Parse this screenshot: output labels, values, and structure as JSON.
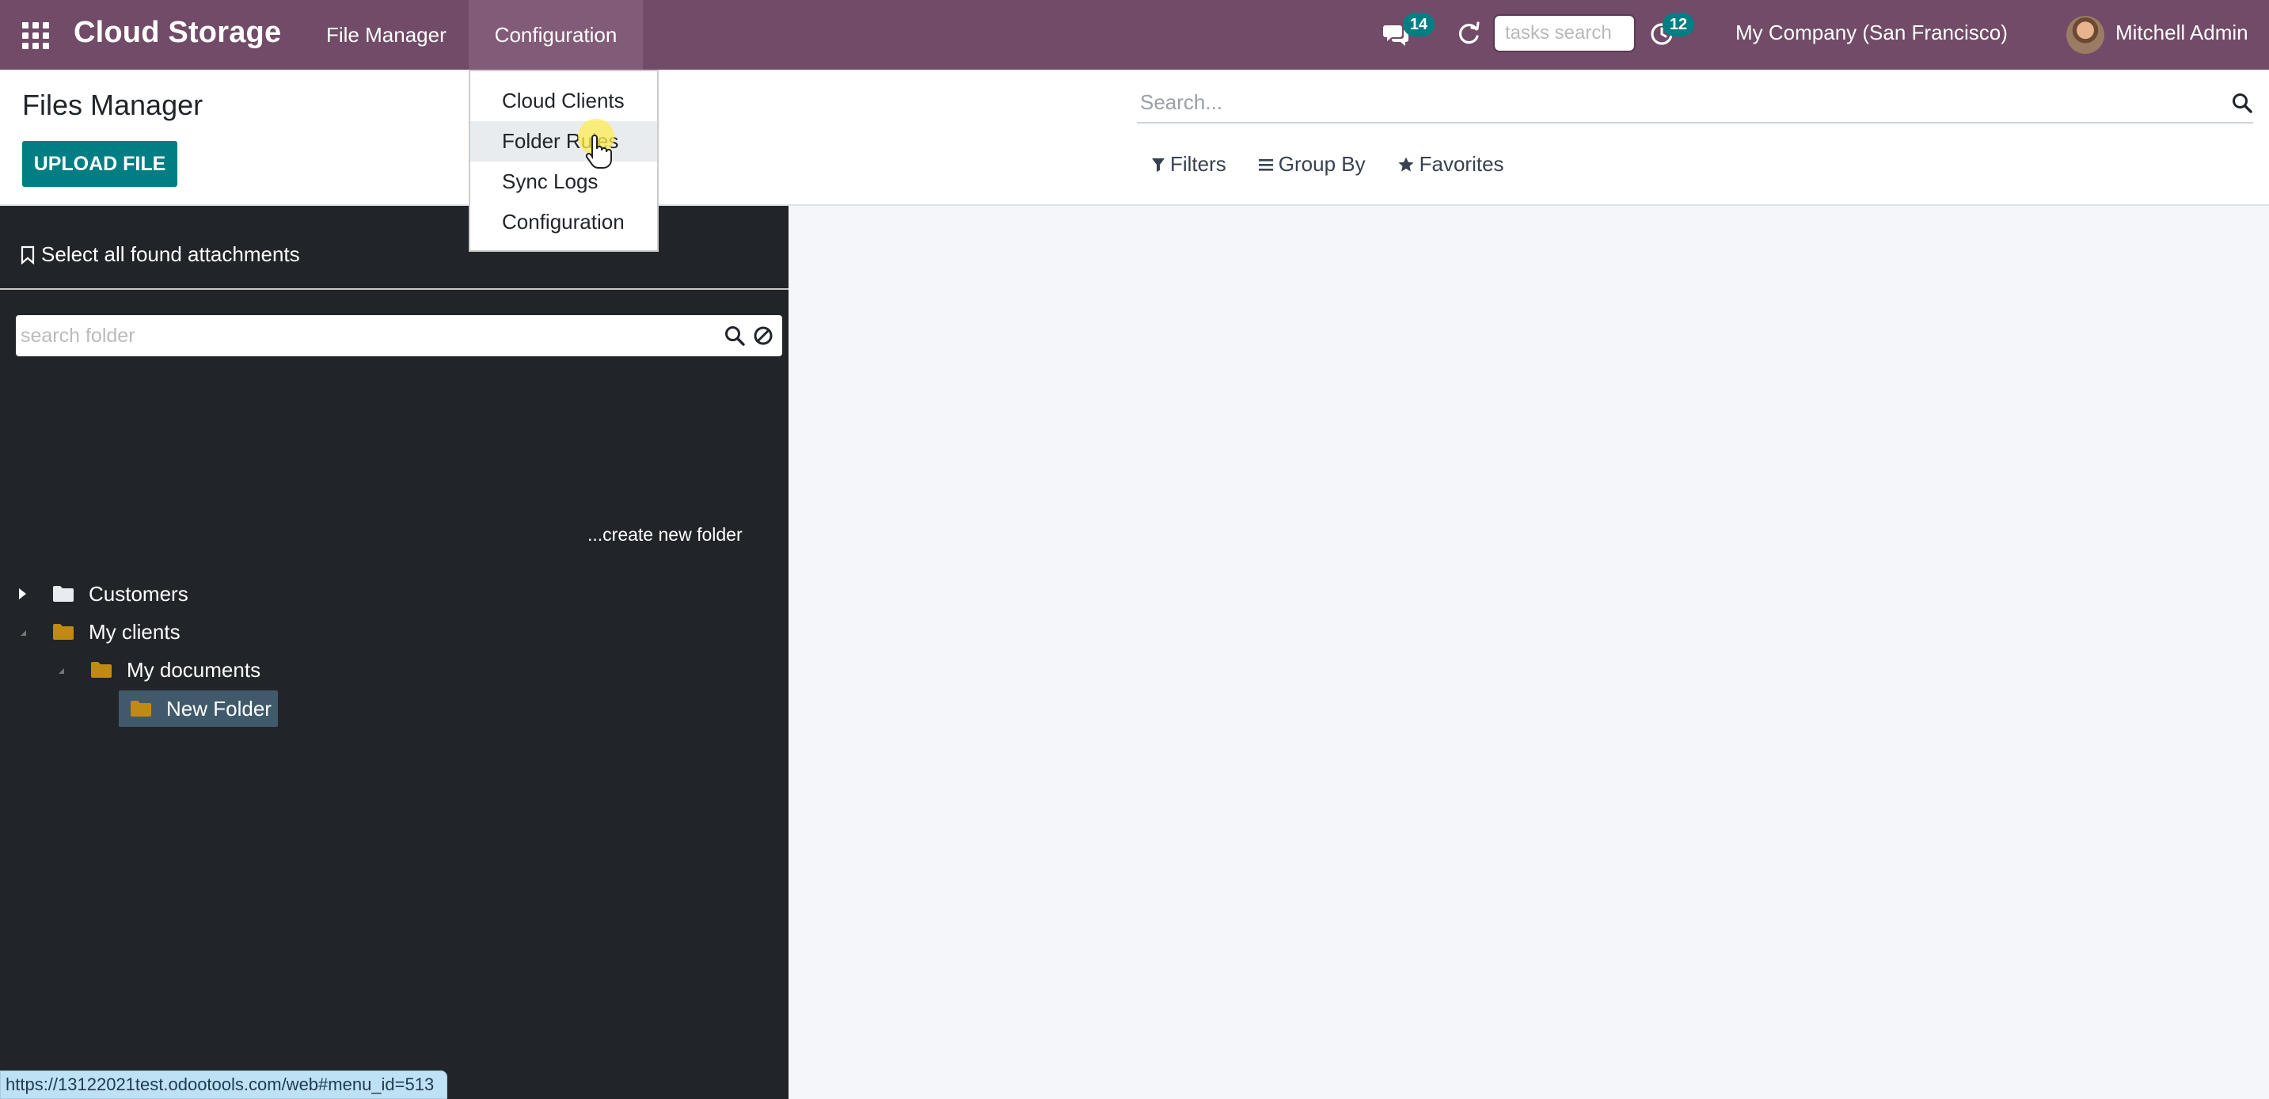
{
  "navbar": {
    "brand": "Cloud Storage",
    "menus": [
      {
        "label": "File Manager"
      },
      {
        "label": "Configuration"
      }
    ],
    "chat_badge": "14",
    "tasks_search_placeholder": "tasks search",
    "activity_badge": "12",
    "company": "My Company (San Francisco)",
    "user": "Mitchell Admin",
    "icons": [
      "apps-icon",
      "chat-icon",
      "refresh-icon",
      "clock-icon",
      "avatar"
    ]
  },
  "dropdown": {
    "items": [
      {
        "label": "Cloud Clients"
      },
      {
        "label": "Folder Rules"
      },
      {
        "label": "Sync Logs"
      },
      {
        "label": "Configuration"
      }
    ],
    "hovered": "Folder Rules"
  },
  "control_panel": {
    "title": "Files Manager",
    "upload_label": "UPLOAD FILE",
    "search_placeholder": "Search...",
    "filters_label": "Filters",
    "group_by_label": "Group By",
    "favorites_label": "Favorites"
  },
  "sidebar": {
    "select_all_label": "Select all found attachments",
    "folder_search_placeholder": "search folder",
    "tree": [
      {
        "label": "Customers",
        "level": 0,
        "state": "collapsed",
        "icon_color": "#e9ecef"
      },
      {
        "label": "My clients",
        "level": 0,
        "state": "expanded",
        "icon_color": "#c18a12"
      },
      {
        "label": "My documents",
        "level": 1,
        "state": "expanded",
        "icon_color": "#c18a12"
      },
      {
        "label": "New Folder",
        "level": 2,
        "state": "selected",
        "icon_color": "#c18a12"
      }
    ],
    "create_folder_label": "...create new folder"
  },
  "status_bar": {
    "url": "https://13122021test.odootools.com/web#menu_id=513"
  },
  "colors": {
    "navbar": "#714b67",
    "primary": "#017e84",
    "sidebar": "#212529",
    "selected_folder": "#415a6b",
    "folder": "#c18a12"
  }
}
